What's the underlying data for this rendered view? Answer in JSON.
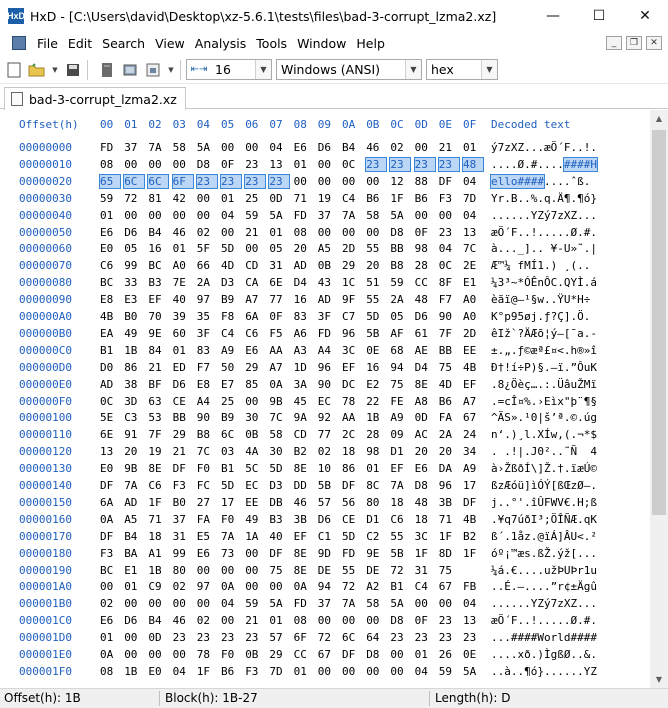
{
  "window": {
    "app_icon": "HxD",
    "title": "HxD - [C:\\Users\\david\\Desktop\\xz-5.6.1\\tests\\files\\bad-3-corrupt_lzma2.xz]",
    "minimize": "—",
    "maximize": "☐",
    "close": "✕"
  },
  "menu": {
    "items": [
      "File",
      "Edit",
      "Search",
      "View",
      "Analysis",
      "Tools",
      "Window",
      "Help"
    ],
    "mdi_minimize": "_",
    "mdi_restore": "❐",
    "mdi_close": "✕"
  },
  "toolbar": {
    "bytes_per_row": "16",
    "charset": "Windows (ANSI)",
    "offset_base": "hex"
  },
  "tab": {
    "label": "bad-3-corrupt_lzma2.xz"
  },
  "editor": {
    "offset_header": "Offset(h)",
    "columns": [
      "00",
      "01",
      "02",
      "03",
      "04",
      "05",
      "06",
      "07",
      "08",
      "09",
      "0A",
      "0B",
      "0C",
      "0D",
      "0E",
      "0F"
    ],
    "decoded_header": "Decoded text",
    "rows": [
      {
        "off": "00000000",
        "hex": [
          "FD",
          "37",
          "7A",
          "58",
          "5A",
          "00",
          "00",
          "04",
          "E6",
          "D6",
          "B4",
          "46",
          "02",
          "00",
          "21",
          "01"
        ],
        "text": "ý7zXZ...æÖ´F..!."
      },
      {
        "off": "00000010",
        "hex": [
          "08",
          "00",
          "00",
          "00",
          "D8",
          "0F",
          "23",
          "13",
          "01",
          "00",
          "0C",
          "23",
          "23",
          "23",
          "23",
          "48"
        ],
        "text": "....Ø.#....####H"
      },
      {
        "off": "00000020",
        "hex": [
          "65",
          "6C",
          "6C",
          "6F",
          "23",
          "23",
          "23",
          "23",
          "00",
          "00",
          "00",
          "00",
          "12",
          "88",
          "DF",
          "04"
        ],
        "text": "ello####....ˆß."
      },
      {
        "off": "00000030",
        "hex": [
          "59",
          "72",
          "81",
          "42",
          "00",
          "01",
          "25",
          "0D",
          "71",
          "19",
          "C4",
          "B6",
          "1F",
          "B6",
          "F3",
          "7D"
        ],
        "text": "Yr.B..%.q.Ä¶.¶ó}"
      },
      {
        "off": "00000040",
        "hex": [
          "01",
          "00",
          "00",
          "00",
          "00",
          "04",
          "59",
          "5A",
          "FD",
          "37",
          "7A",
          "58",
          "5A",
          "00",
          "00",
          "04"
        ],
        "text": "......YZý7zXZ..."
      },
      {
        "off": "00000050",
        "hex": [
          "E6",
          "D6",
          "B4",
          "46",
          "02",
          "00",
          "21",
          "01",
          "08",
          "00",
          "00",
          "00",
          "D8",
          "0F",
          "23",
          "13"
        ],
        "text": "æÖ´F..!.....Ø.#."
      },
      {
        "off": "00000060",
        "hex": [
          "E0",
          "05",
          "16",
          "01",
          "5F",
          "5D",
          "00",
          "05",
          "20",
          "A5",
          "2D",
          "55",
          "BB",
          "98",
          "04",
          "7C"
        ],
        "text": "à..._].. ¥-U»˜.|"
      },
      {
        "off": "00000070",
        "hex": [
          "C6",
          "99",
          "BC",
          "A0",
          "66",
          "4D",
          "CD",
          "31",
          "AD",
          "0B",
          "29",
          "20",
          "B8",
          "28",
          "0C",
          "2E"
        ],
        "text": "Æ™¼ fMÍ1.) ¸(.."
      },
      {
        "off": "00000080",
        "hex": [
          "BC",
          "33",
          "B3",
          "7E",
          "2A",
          "D3",
          "CA",
          "6E",
          "D4",
          "43",
          "1C",
          "51",
          "59",
          "CC",
          "8F",
          "E1"
        ],
        "text": "¼3³~*ÓÊnÔC.QYÌ.á"
      },
      {
        "off": "00000090",
        "hex": [
          "E8",
          "E3",
          "EF",
          "40",
          "97",
          "B9",
          "A7",
          "77",
          "16",
          "AD",
          "9F",
          "55",
          "2A",
          "48",
          "F7",
          "A0"
        ],
        "text": "èãï@—¹§w..ŸU*H÷ "
      },
      {
        "off": "000000A0",
        "hex": [
          "4B",
          "B0",
          "70",
          "39",
          "35",
          "F8",
          "6A",
          "0F",
          "83",
          "3F",
          "C7",
          "5D",
          "05",
          "D6",
          "90",
          "A0"
        ],
        "text": "K°p95øj.ƒ?Ç].Ö. "
      },
      {
        "off": "000000B0",
        "hex": [
          "EA",
          "49",
          "9E",
          "60",
          "3F",
          "C4",
          "C6",
          "F5",
          "A6",
          "FD",
          "96",
          "5B",
          "AF",
          "61",
          "7F",
          "2D"
        ],
        "text": "êIž`?ÄÆõ¦ý–[¯a.-"
      },
      {
        "off": "000000C0",
        "hex": [
          "B1",
          "1B",
          "84",
          "01",
          "83",
          "A9",
          "E6",
          "AA",
          "A3",
          "A4",
          "3C",
          "0E",
          "68",
          "AE",
          "BB",
          "EE"
        ],
        "text": "±.„.ƒ©æª£¤<.h®»î"
      },
      {
        "off": "000000D0",
        "hex": [
          "D0",
          "86",
          "21",
          "ED",
          "F7",
          "50",
          "29",
          "A7",
          "1D",
          "96",
          "EF",
          "16",
          "94",
          "D4",
          "75",
          "4B"
        ],
        "text": "Ð†!í÷P)§.–ï.”ÔuK"
      },
      {
        "off": "000000E0",
        "hex": [
          "AD",
          "38",
          "BF",
          "D6",
          "E8",
          "E7",
          "85",
          "0A",
          "3A",
          "90",
          "DC",
          "E2",
          "75",
          "8E",
          "4D",
          "EF"
        ],
        "text": ".8¿Öèç….:.ÜâuŽMï"
      },
      {
        "off": "000000F0",
        "hex": [
          "0C",
          "3D",
          "63",
          "CE",
          "A4",
          "25",
          "00",
          "9B",
          "45",
          "EC",
          "78",
          "22",
          "FE",
          "A8",
          "B6",
          "A7"
        ],
        "text": ".=cÎ¤%.›Eìx\"þ¨¶§"
      },
      {
        "off": "00000100",
        "hex": [
          "5E",
          "C3",
          "53",
          "BB",
          "90",
          "B9",
          "30",
          "7C",
          "9A",
          "92",
          "AA",
          "1B",
          "A9",
          "0D",
          "FA",
          "67"
        ],
        "text": "^ÃS».¹0|š’ª.©.úg"
      },
      {
        "off": "00000110",
        "hex": [
          "6E",
          "91",
          "7F",
          "29",
          "B8",
          "6C",
          "0B",
          "58",
          "CD",
          "77",
          "2C",
          "28",
          "09",
          "AC",
          "2A",
          "24"
        ],
        "text": "n‘.)¸l.XÍw,(.¬*$"
      },
      {
        "off": "00000120",
        "hex": [
          "13",
          "20",
          "19",
          "21",
          "7C",
          "03",
          "4A",
          "30",
          "B2",
          "02",
          "18",
          "98",
          "D1",
          "20",
          "20",
          "34"
        ],
        "text": ". .!|.J0²..˜Ñ  4"
      },
      {
        "off": "00000130",
        "hex": [
          "E0",
          "9B",
          "8E",
          "DF",
          "F0",
          "B1",
          "5C",
          "5D",
          "8E",
          "10",
          "86",
          "01",
          "EF",
          "E6",
          "DA",
          "A9"
        ],
        "text": "à›ŽßðÍ\\]Ž.†.ïæÚ©"
      },
      {
        "off": "00000140",
        "hex": [
          "DF",
          "7A",
          "C6",
          "F3",
          "FC",
          "5D",
          "EC",
          "D3",
          "DD",
          "5B",
          "DF",
          "8C",
          "7A",
          "D8",
          "96",
          "17"
        ],
        "text": "ßzÆóü]ìÓÝ[ßŒzØ–."
      },
      {
        "off": "00000150",
        "hex": [
          "6A",
          "AD",
          "1F",
          "B0",
          "27",
          "17",
          "EE",
          "DB",
          "46",
          "57",
          "56",
          "80",
          "18",
          "48",
          "3B",
          "DF"
        ],
        "text": "j..°'.îÛFWV€.H;ß"
      },
      {
        "off": "00000160",
        "hex": [
          "0A",
          "A5",
          "71",
          "37",
          "FA",
          "F0",
          "49",
          "B3",
          "3B",
          "D6",
          "CE",
          "D1",
          "C6",
          "18",
          "71",
          "4B"
        ],
        "text": ".¥q7úðI³;ÖÎÑÆ.qK"
      },
      {
        "off": "00000170",
        "hex": [
          "DF",
          "B4",
          "18",
          "31",
          "E5",
          "7A",
          "1A",
          "40",
          "EF",
          "C1",
          "5D",
          "C2",
          "55",
          "3C",
          "1F",
          "B2"
        ],
        "text": "ß´.1åz.@ïÁ]ÂU<.²"
      },
      {
        "off": "00000180",
        "hex": [
          "F3",
          "BA",
          "A1",
          "99",
          "E6",
          "73",
          "00",
          "DF",
          "8E",
          "9D",
          "FD",
          "9E",
          "5B",
          "1F",
          "8D",
          "1F"
        ],
        "text": "óº¡™æs.ßŽ.ýž[..."
      },
      {
        "off": "00000190",
        "hex": [
          "BC",
          "E1",
          "1B",
          "80",
          "00",
          "00",
          "00",
          "75",
          "8E",
          "DE",
          "55",
          "DE",
          "72",
          "31",
          "75"
        ],
        "text": "¼á.€....užÞUÞr1u"
      },
      {
        "off": "000001A0",
        "hex": [
          "00",
          "01",
          "C9",
          "02",
          "97",
          "0A",
          "00",
          "00",
          "0A",
          "94",
          "72",
          "A2",
          "B1",
          "C4",
          "67",
          "FB"
        ],
        "text": "..É.—....”r¢±Ägû"
      },
      {
        "off": "000001B0",
        "hex": [
          "02",
          "00",
          "00",
          "00",
          "00",
          "04",
          "59",
          "5A",
          "FD",
          "37",
          "7A",
          "58",
          "5A",
          "00",
          "00",
          "04"
        ],
        "text": "......YZý7zXZ..."
      },
      {
        "off": "000001C0",
        "hex": [
          "E6",
          "D6",
          "B4",
          "46",
          "02",
          "00",
          "21",
          "01",
          "08",
          "00",
          "00",
          "00",
          "D8",
          "0F",
          "23",
          "13"
        ],
        "text": "æÖ´F..!.....Ø.#."
      },
      {
        "off": "000001D0",
        "hex": [
          "01",
          "00",
          "0D",
          "23",
          "23",
          "23",
          "23",
          "57",
          "6F",
          "72",
          "6C",
          "64",
          "23",
          "23",
          "23",
          "23"
        ],
        "text": "...####World####"
      },
      {
        "off": "000001E0",
        "hex": [
          "0A",
          "00",
          "00",
          "00",
          "78",
          "F0",
          "0B",
          "29",
          "CC",
          "67",
          "DF",
          "D8",
          "00",
          "01",
          "26",
          "0E"
        ],
        "text": "....xð.)ÌgßØ..&."
      },
      {
        "off": "000001F0",
        "hex": [
          "08",
          "1B",
          "E0",
          "04",
          "1F",
          "B6",
          "F3",
          "7D",
          "01",
          "00",
          "00",
          "00",
          "00",
          "04",
          "59",
          "5A"
        ],
        "text": "..à..¶ó}......YZ"
      }
    ],
    "selection": {
      "start": 27,
      "end": 39
    }
  },
  "status": {
    "offset": "Offset(h): 1B",
    "block": "Block(h): 1B-27",
    "length": "Length(h): D"
  },
  "icons": {
    "new": "new-file-icon",
    "open": "open-folder-icon",
    "save": "save-icon",
    "disk": "disk-editor-icon",
    "ram": "ram-editor-icon",
    "open_disk_image": "disk-image-icon",
    "bytes_per_row": "bytes-per-row-icon"
  }
}
